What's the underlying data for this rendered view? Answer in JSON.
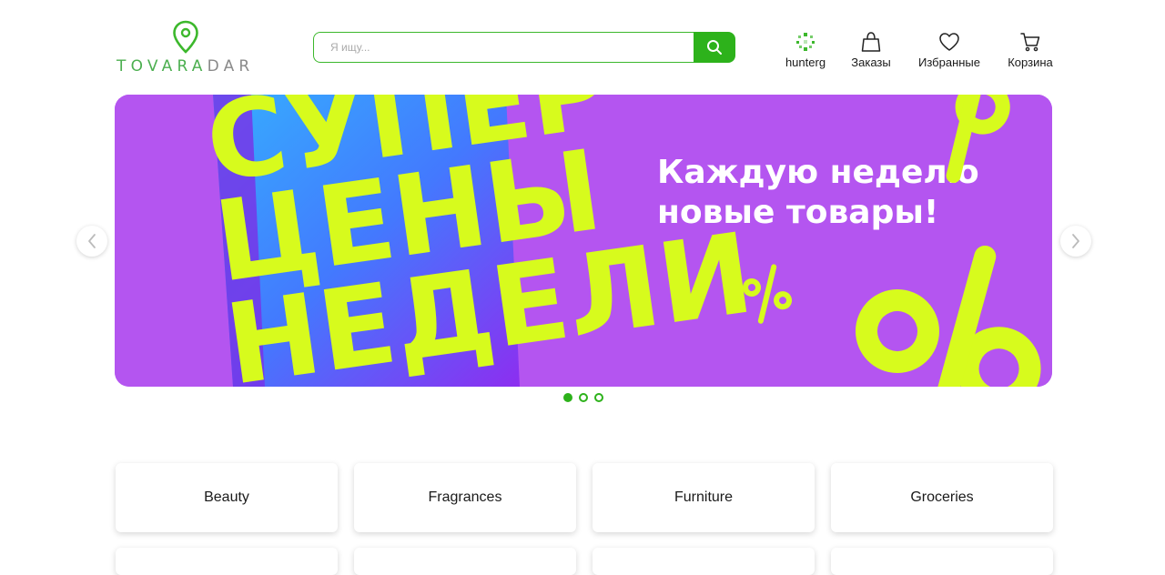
{
  "brand": {
    "logo_text_green": "TOVARA",
    "logo_text_grey": "DAR"
  },
  "search": {
    "placeholder": "Я ищу..."
  },
  "nav": [
    {
      "label": "hunterg",
      "icon": "avatar-icon"
    },
    {
      "label": "Заказы",
      "icon": "shopping-bag-icon"
    },
    {
      "label": "Избранные",
      "icon": "heart-icon"
    },
    {
      "label": "Корзина",
      "icon": "cart-icon"
    }
  ],
  "banner": {
    "headline": [
      "СУПЕР",
      "ЦЕНЫ",
      "НЕДЕЛИ"
    ],
    "tagline": [
      "Каждую неделю",
      "новые товары!"
    ],
    "colors": {
      "background": "#b455f0",
      "accent": "#d7fb1d"
    }
  },
  "carousel": {
    "slides": 3,
    "active_index": 0
  },
  "categories": [
    "Beauty",
    "Fragrances",
    "Furniture",
    "Groceries"
  ],
  "colors": {
    "brand_green": "#2db21b",
    "logo_grey": "#8a8a8a"
  }
}
